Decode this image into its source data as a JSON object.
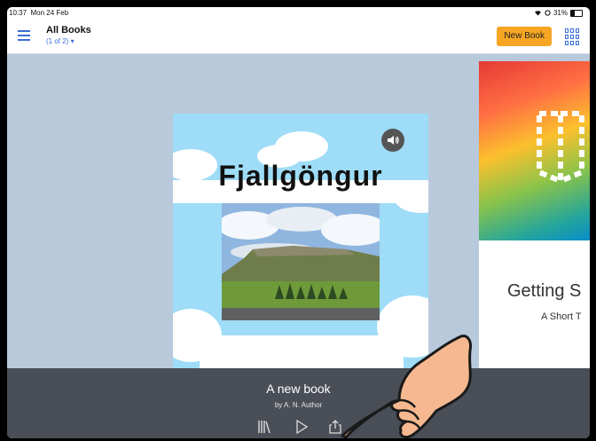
{
  "status": {
    "time": "10:37",
    "date": "Mon 24 Feb",
    "battery": "31%",
    "battery_level": 0.31,
    "wifi_icon": "wifi-icon"
  },
  "header": {
    "title": "All Books",
    "subtitle": "(1 of 2) ▾",
    "new_book_label": "New Book",
    "accent": "#3b6dd8",
    "button_color": "#f6a623"
  },
  "carousel": {
    "current": {
      "cover_title": "Fjallgöngur",
      "audio_icon": "speaker-icon"
    },
    "next": {
      "title": "Getting S",
      "subtitle": "A Short T"
    }
  },
  "book_info": {
    "title": "A new book",
    "author": "by A. N. Author"
  },
  "toolbar": {
    "icons": [
      "library-icon",
      "play-icon",
      "share-icon"
    ]
  }
}
